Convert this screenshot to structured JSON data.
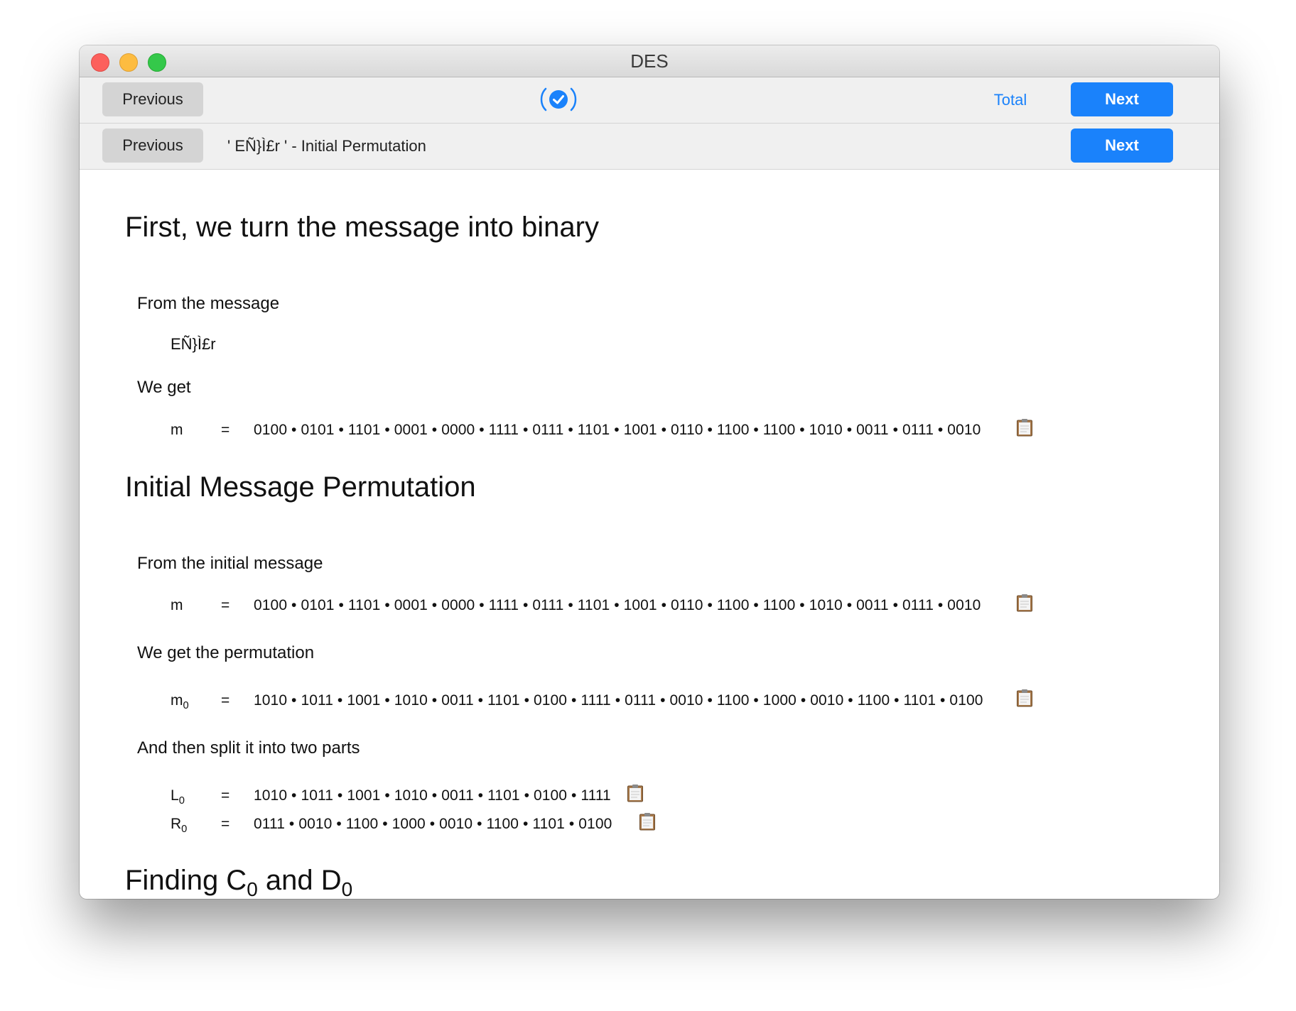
{
  "window": {
    "title": "DES"
  },
  "toolbar_top": {
    "previous_label": "Previous",
    "progress_icon": "checkmark-circle-icon",
    "total_label": "Total",
    "next_label": "Next"
  },
  "toolbar_step": {
    "previous_label": "Previous",
    "step_label": "' EÑ}Ì£r ' - Initial Permutation",
    "next_label": "Next"
  },
  "section1": {
    "heading": "First, we turn the message into binary",
    "from_label": "From the message",
    "message": "EÑ}Ì£r",
    "we_get_label": "We get",
    "m_label": "m",
    "equals": "=",
    "m_value": "0100 • 0101 • 1101 • 0001 • 0000 • 1111 • 0111 • 1101 • 1001 • 0110 • 1100 • 1100 • 1010 • 0011 • 0111 • 0010"
  },
  "section2": {
    "heading": "Initial Message Permutation",
    "from_label": "From the initial message",
    "m_label": "m",
    "equals": "=",
    "m_value": "0100 • 0101 • 1101 • 0001 • 0000 • 1111 • 0111 • 1101 • 1001 • 0110 • 1100 • 1100 • 1010 • 0011 • 0111 • 0010",
    "perm_label": "We get the permutation",
    "m0_base": "m",
    "m0_sub": "0",
    "m0_value": "1010 • 1011 • 1001 • 1010 • 0011 • 1101 • 0100 • 1111 • 0111 • 0010 • 1100 • 1000 • 0010 • 1100 • 1101 • 0100",
    "split_label": "And then split it into two parts",
    "l0_base": "L",
    "l0_sub": "0",
    "l0_value": "1010 • 1011 • 1001 • 1010 • 0011 • 1101 • 0100 • 1111",
    "r0_base": "R",
    "r0_sub": "0",
    "r0_value": "0111 • 0010 • 1100 • 1000 • 0010 • 1100 • 1101 • 0100"
  },
  "section3": {
    "heading_part1": "Finding C",
    "heading_sub1": "0",
    "heading_part2": " and D",
    "heading_sub2": "0"
  },
  "icons": {
    "copy": "clipboard-icon"
  },
  "colors": {
    "accent": "#1a82fb"
  }
}
